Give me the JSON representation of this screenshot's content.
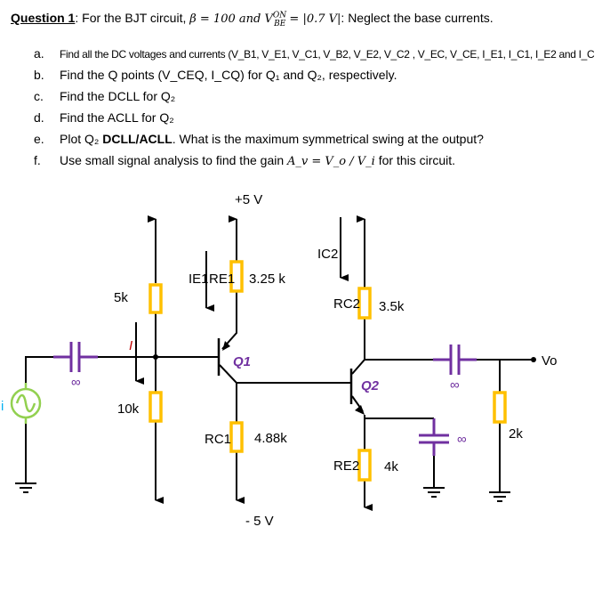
{
  "question": {
    "label": "Question 1",
    "intro": ": For the BJT circuit, ",
    "math": "β = 100 and V",
    "math_sup": "ON",
    "math_sub": "BE",
    "math_tail": " = |0.7 V|",
    "tail": ": Neglect the base currents."
  },
  "items": [
    {
      "letter": "a.",
      "text": "Find all the DC voltages and currents (V_B1, V_E1, V_C1, V_B2, V_E2, V_C2 , V_EC, V_CE, I_E1, I_C1, I_E2 and I_C"
    },
    {
      "letter": "b.",
      "text": "Find the Q points (V_CEQ, I_CQ) for Q₁ and Q₂, respectively."
    },
    {
      "letter": "c.",
      "text": "Find the DCLL for Q₂"
    },
    {
      "letter": "d.",
      "text": "Find the ACLL for Q₂"
    },
    {
      "letter": "e.",
      "text_pre": "Plot Q₂ ",
      "text_bold": "DCLL/ACLL",
      "text_post": ". What is the maximum symmetrical swing at the output?"
    },
    {
      "letter": "f.",
      "text_pre": "Use small signal analysis to find the gain ",
      "gain": "A_v = V_o / V_i",
      "text_post": " for this circuit."
    }
  ],
  "circuit": {
    "vcc": "+5 V",
    "vee": "- 5 V",
    "r_top_bias": "5k",
    "r_bottom_bias": "10k",
    "re1_label": "RE1",
    "re1_value": "3.25 k",
    "rc1_label": "RC1",
    "rc1_value": "4.88k",
    "rc2_label": "RC2",
    "rc2_value": "3.5k",
    "re2_label": "RE2",
    "re2_value": "4k",
    "rl_value": "2k",
    "q1": "Q1",
    "q2": "Q2",
    "i_label": "I",
    "ie1_label": "IE1",
    "ic2_label": "IC2",
    "cap_value": "∞",
    "vout": "Vo",
    "vin_partial": "i",
    "colors": {
      "resistor": "#ffc000",
      "capacitor": "#7030a0",
      "source": "#92d050",
      "transistor_label": "#7030a0",
      "current_label": "#c00000"
    }
  }
}
